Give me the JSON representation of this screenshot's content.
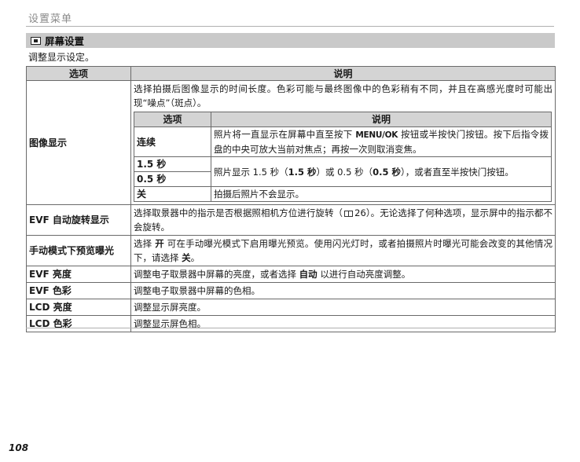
{
  "header": {
    "title": "设置菜单"
  },
  "section": {
    "title": "屏幕设置",
    "icon": "screen-settings-icon"
  },
  "intro": "调整显示设定。",
  "table": {
    "col_option": "选项",
    "col_desc": "说明",
    "image_display": {
      "option": "图像显示",
      "desc": "选择拍摄后图像显示的时间长度。色彩可能与最终图像中的色彩稍有不同，并且在高感光度时可能出现“噪点”（斑点）。",
      "sub": {
        "col_option": "选项",
        "col_desc": "说明",
        "continuous": {
          "option": "连续",
          "desc_a": "照片将一直显示在屏幕中直至按下",
          "key": "MENU/OK",
          "desc_b": "按钮或半按快门按钮。按下后指令拨盘的中央可放大当前对焦点；再按一次则取消变焦。"
        },
        "sec15": {
          "option": "1.5 秒"
        },
        "sec05": {
          "option": "0.5 秒"
        },
        "timed_desc_a": "照片显示 1.5 秒（",
        "timed_b1": "1.5 秒",
        "timed_desc_c": "）或 0.5 秒（",
        "timed_b2": "0.5 秒",
        "timed_desc_d": "），或者直至半按快门按钮。",
        "off": {
          "option": "关",
          "desc": "拍摄后照片不会显示。"
        }
      }
    },
    "evf_rotate": {
      "option": "EVF 自动旋转显示",
      "desc_a": "选择取景器中的指示是否根据照相机方位进行旋转（",
      "page_ref": "26",
      "desc_b": "）。无论选择了何种选项，显示屏中的指示都不会旋转。"
    },
    "preview_exposure": {
      "option": "手动模式下预览曝光",
      "desc_a": "选择",
      "on": "开",
      "desc_b": "可在手动曝光模式下启用曝光预览。使用闪光灯时，或者拍摄照片时曝光可能会改变的其他情况下，请选择",
      "off": "关",
      "desc_c": "。"
    },
    "evf_brightness": {
      "option": "EVF 亮度",
      "desc_a": "调整电子取景器中屏幕的亮度，或者选择",
      "auto": "自动",
      "desc_b": "以进行自动亮度调整。"
    },
    "evf_color": {
      "option": "EVF 色彩",
      "desc": "调整电子取景器中屏幕的色相。"
    },
    "lcd_brightness": {
      "option": "LCD 亮度",
      "desc": "调整显示屏亮度。"
    },
    "lcd_color": {
      "option": "LCD 色彩",
      "desc": "调整显示屏色相。"
    }
  },
  "page_number": "108"
}
